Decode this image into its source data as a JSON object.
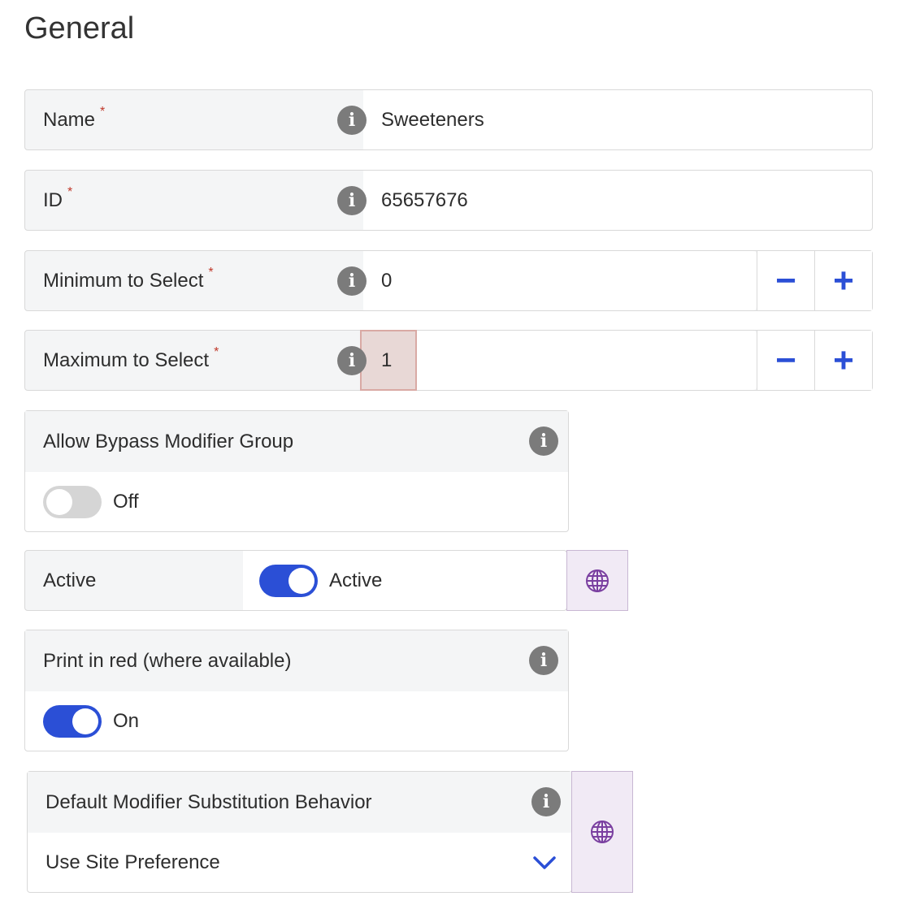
{
  "page": {
    "title": "General"
  },
  "fields": {
    "name": {
      "label": "Name",
      "required_mark": "*",
      "value": "Sweeteners"
    },
    "id": {
      "label": "ID",
      "required_mark": "*",
      "value": "65657676"
    },
    "min_select": {
      "label": "Minimum to Select",
      "required_mark": "*",
      "value": "0",
      "decrement": "−",
      "increment": "+"
    },
    "max_select": {
      "label": "Maximum to Select",
      "required_mark": "*",
      "value": "1",
      "decrement": "−",
      "increment": "+"
    }
  },
  "bypass": {
    "label": "Allow Bypass Modifier Group",
    "state": "Off"
  },
  "active": {
    "label": "Active",
    "state": "Active"
  },
  "print_red": {
    "label": "Print in red (where available)",
    "state": "On"
  },
  "substitution": {
    "label": "Default Modifier Substitution Behavior",
    "value": "Use Site Preference"
  },
  "info_glyph": "i",
  "colors": {
    "accent": "#2b4fd6",
    "required": "#c0392b",
    "globe": "#7a3fa0"
  },
  "icons": {
    "info": "info-icon",
    "globe": "globe-icon",
    "chevron": "chevron-down-icon"
  }
}
